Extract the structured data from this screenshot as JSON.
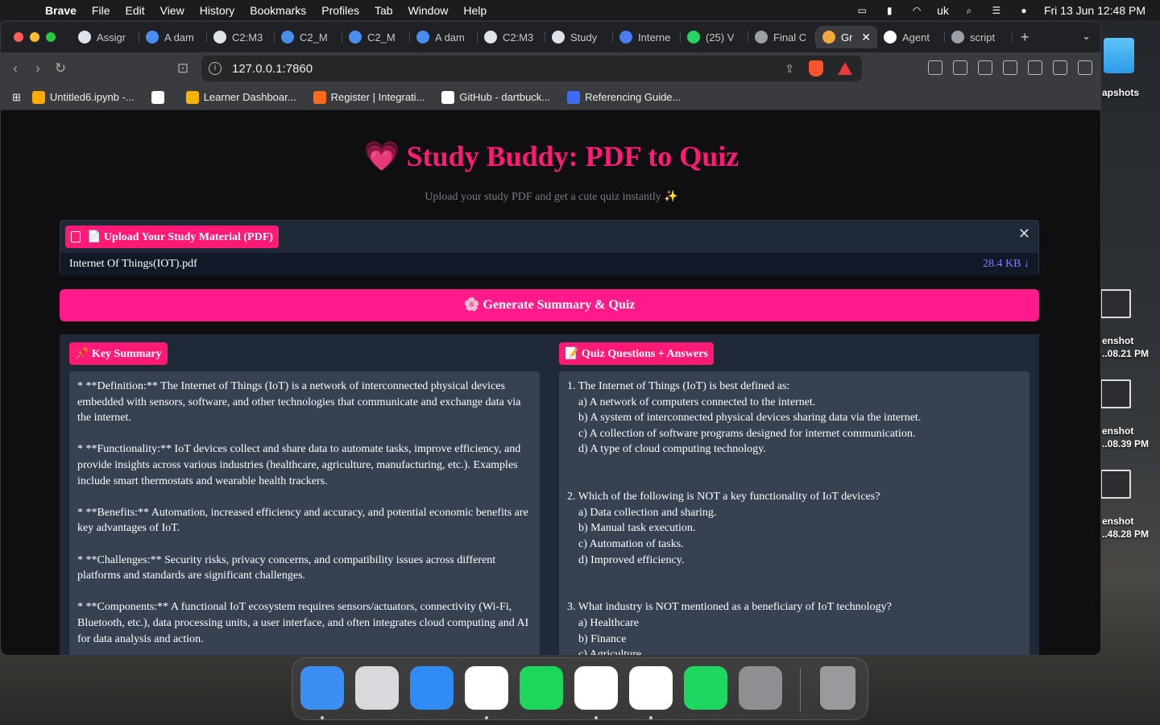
{
  "menubar": {
    "app_name": "Brave",
    "items": [
      "File",
      "Edit",
      "View",
      "History",
      "Bookmarks",
      "Profiles",
      "Tab",
      "Window",
      "Help"
    ],
    "input_source": "uk",
    "datetime": "Fri 13 Jun  12:48 PM"
  },
  "browser": {
    "tabs": [
      {
        "label": "Assigr",
        "color": "#dfe3ea"
      },
      {
        "label": "A dam",
        "color": "#4a8df0"
      },
      {
        "label": "C2:M3",
        "color": "#dfe3ea"
      },
      {
        "label": "C2_M",
        "color": "#4a8df0"
      },
      {
        "label": "C2_M",
        "color": "#4a8df0"
      },
      {
        "label": "A dam",
        "color": "#4a8df0"
      },
      {
        "label": "C2:M3",
        "color": "#dfe3ea"
      },
      {
        "label": "Study",
        "color": "#dfe3ea"
      },
      {
        "label": "Interne",
        "color": "#4a7cf0"
      },
      {
        "label": "(25) V",
        "color": "#25d366"
      },
      {
        "label": "Final C",
        "color": "#9aa0a6"
      },
      {
        "label": "Gr",
        "color": "#f2a93b",
        "active": true
      },
      {
        "label": "Agent",
        "color": "#ffffff"
      },
      {
        "label": "script",
        "color": "#9aa0a6"
      }
    ],
    "url": "127.0.0.1:7860",
    "bookmarks": [
      {
        "label": "Untitled6.ipynb -...",
        "color": "#f9ab00"
      },
      {
        "label": "",
        "color": "#ffffff"
      },
      {
        "label": "Learner Dashboar...",
        "color": "#f5b400"
      },
      {
        "label": "Register | Integrati...",
        "color": "#ff6a1a"
      },
      {
        "label": "GitHub - dartbuck...",
        "color": "#ffffff"
      },
      {
        "label": "Referencing Guide...",
        "color": "#3d6bf5"
      }
    ]
  },
  "app": {
    "title": "Study Buddy: PDF to Quiz",
    "title_icon": "💗",
    "subtitle": "Upload your study PDF and get a cute quiz instantly ✨",
    "upload_label": "📄 Upload Your Study Material (PDF)",
    "file_name": "Internet Of Things(IOT).pdf",
    "file_size": "28.4 KB ↓",
    "generate_button": "🌸 Generate Summary & Quiz",
    "summary_label": "📌 Key Summary",
    "quiz_label": "📝 Quiz Questions + Answers",
    "summary": [
      "* **Definition:** The Internet of Things (IoT) is a network of interconnected physical devices embedded with sensors, software, and other technologies that communicate and exchange data via the internet.",
      "* **Functionality:** IoT devices collect and share data to automate tasks, improve efficiency, and provide insights across various industries (healthcare, agriculture, manufacturing, etc.).  Examples include smart thermostats and wearable health trackers.",
      "* **Benefits:**  Automation, increased efficiency and accuracy, and potential economic benefits are key advantages of IoT.",
      "* **Challenges:** Security risks, privacy concerns, and compatibility issues across different platforms and standards are significant challenges.",
      "* **Components:**  A functional IoT ecosystem requires sensors/actuators, connectivity (Wi-Fi, Bluetooth, etc.), data processing units, a user interface, and often integrates cloud computing and AI for data analysis and action."
    ],
    "quiz": [
      {
        "q": "1.  The Internet of Things (IoT) is best defined as:",
        "options": [
          "a) A network of computers connected to the internet.",
          "b) A system of interconnected physical devices sharing data via the internet.",
          "c) A collection of software programs designed for internet communication.",
          "d) A type of cloud computing technology."
        ]
      },
      {
        "q": "2.  Which of the following is NOT a key functionality of IoT devices?",
        "options": [
          "a) Data collection and sharing.",
          "b) Manual task execution.",
          "c) Automation of tasks.",
          "d) Improved efficiency."
        ]
      },
      {
        "q": "3.  What industry is NOT mentioned as a beneficiary of IoT technology?",
        "options": [
          "a) Healthcare",
          "b) Finance",
          "c) Agriculture"
        ]
      }
    ]
  },
  "desktop": {
    "folder_label": "apshots",
    "screenshots": [
      {
        "l1": "enshot",
        "l2": "..08.21 PM"
      },
      {
        "l1": "enshot",
        "l2": "..08.39 PM"
      },
      {
        "l1": "enshot",
        "l2": "..48.28 PM"
      }
    ]
  },
  "dock": {
    "apps": [
      {
        "name": "finder-icon",
        "color": "#3b8ff2",
        "running": true
      },
      {
        "name": "launchpad-icon",
        "color": "#d9d9dd",
        "running": false
      },
      {
        "name": "mail-icon",
        "color": "#2f8cf5",
        "running": false
      },
      {
        "name": "vscode-icon",
        "color": "#ffffff",
        "running": true
      },
      {
        "name": "pycharm-icon",
        "color": "#1dd75b",
        "running": false
      },
      {
        "name": "safari-icon",
        "color": "#ffffff",
        "running": true
      },
      {
        "name": "brave-icon",
        "color": "#ffffff",
        "running": true
      },
      {
        "name": "spotify-icon",
        "color": "#1ed760",
        "running": false
      },
      {
        "name": "system-settings-icon",
        "color": "#8e8e93",
        "running": false
      },
      {
        "name": "trash-icon",
        "color": "#9a9a9e",
        "running": false
      }
    ]
  }
}
